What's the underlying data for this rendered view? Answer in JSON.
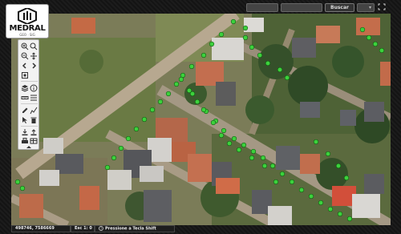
{
  "app": {
    "logo_text": "MEDRAL",
    "logo_sub": "GEO · SIG"
  },
  "topbar": {
    "search_label": "Buscar",
    "search_placeholder": "",
    "dropdown_icon": "chevron-down-icon",
    "expand_icon": "expand-icon"
  },
  "toolbar": {
    "tools": [
      "zoom-in-icon",
      "zoom-box-icon",
      "zoom-out-icon",
      "pan-icon",
      "previous-extent-icon",
      "next-extent-icon",
      "full-extent-icon",
      "layers-icon",
      "info-icon",
      "measure-icon",
      "list-icon",
      "edit-icon",
      "draw-icon",
      "select-icon",
      "delete-icon",
      "download-icon",
      "upload-icon",
      "print-icon",
      "table-icon",
      "collapse-icon"
    ]
  },
  "statusbar": {
    "coordinates": "498746, 7586669",
    "scale": "Esc 1: 0",
    "hint": "Pressione a Tecla Shift"
  },
  "colors": {
    "frame": "#141414",
    "marker": "#3dd13d",
    "accent": "#e0e0e0"
  }
}
